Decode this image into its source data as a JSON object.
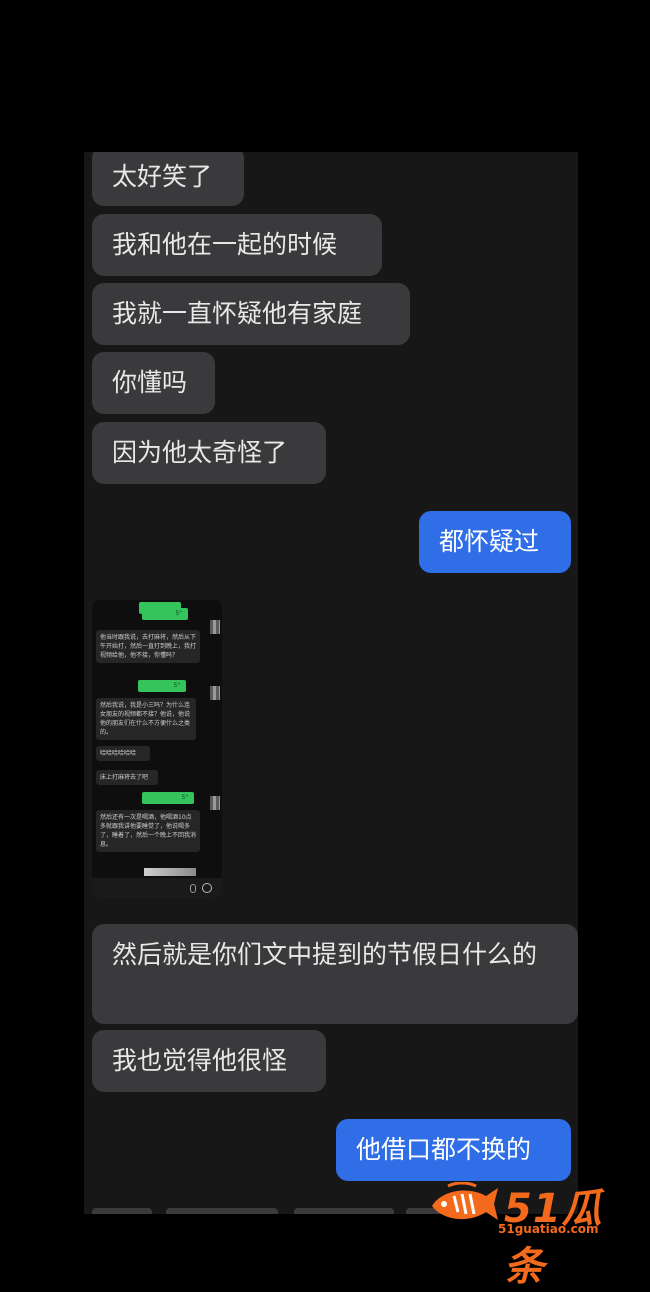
{
  "messages": [
    {
      "id": "m1",
      "side": "in",
      "text": "太好笑了"
    },
    {
      "id": "m2",
      "side": "in",
      "text": "我和他在一起的时候"
    },
    {
      "id": "m3",
      "side": "in",
      "text": "我就一直怀疑他有家庭"
    },
    {
      "id": "m4",
      "side": "in",
      "text": "你懂吗"
    },
    {
      "id": "m5",
      "side": "in",
      "text": "因为他太奇怪了"
    },
    {
      "id": "m6",
      "side": "out",
      "text": "都怀疑过"
    },
    {
      "id": "m8",
      "side": "in",
      "text": "然后就是你们文中提到的节假日什么的"
    },
    {
      "id": "m9",
      "side": "in",
      "text": "我也觉得他很怪"
    },
    {
      "id": "m10",
      "side": "out",
      "text": "他借口都不换的"
    }
  ],
  "thumbnail": {
    "voice_duration": "5\"",
    "bubbles": [
      "他当时跟我说，去打麻将，然后从下午开始打，然后一直打到晚上，我打视频给他，他不接，你懂吗？",
      "然后我说，我是小三吗？为什么连女朋友的视频都不接？他说，他说他的朋友们在什么不方便什么之类的。",
      "哈哈哈哈哈哈",
      "床上打麻将去了吧",
      "然后还有一次是喝酒，他喝酒10点多就跟我讲他要睡觉了，他说喝多了，睡着了，然后一个晚上不回我消息。"
    ]
  },
  "watermark": {
    "brand": "51瓜条",
    "url": "51guatiao.com",
    "color": "#f36a1c"
  }
}
